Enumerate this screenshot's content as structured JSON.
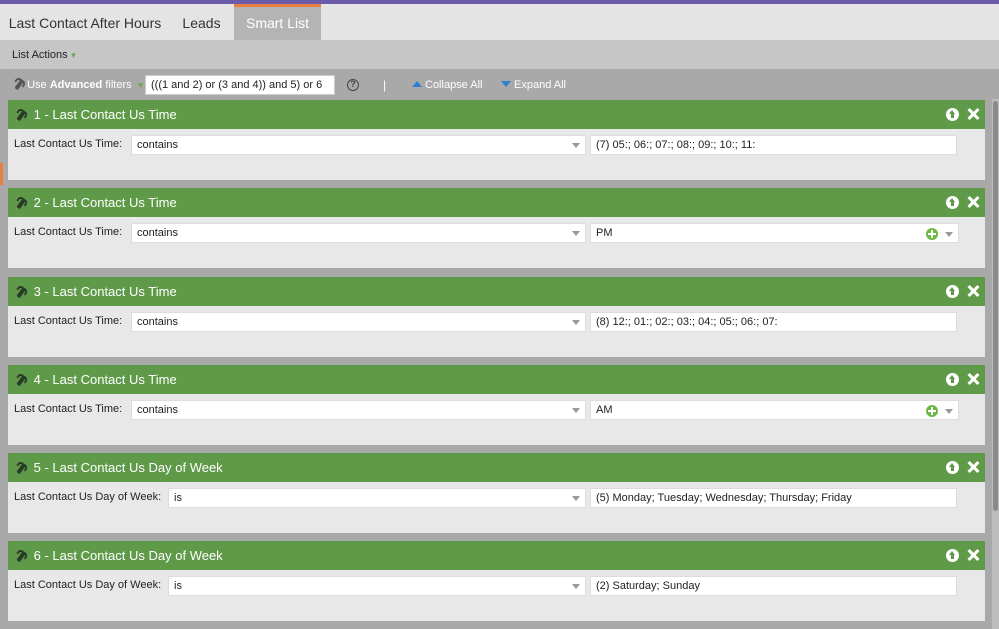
{
  "tabs": [
    {
      "label": "Last Contact After Hours"
    },
    {
      "label": "Leads"
    },
    {
      "label": "Smart List"
    }
  ],
  "list_actions": {
    "label": "List Actions"
  },
  "filter_bar": {
    "use_prefix": "Use ",
    "advanced": "Advanced",
    "filters_suffix": " filters",
    "logic_value": "(((1 and 2) or (3 and 4)) and 5) or 6",
    "separator": "|",
    "collapse_all": "Collapse All",
    "expand_all": "Expand All"
  },
  "filters": [
    {
      "title": "1 - Last Contact Us Time",
      "label": "Last Contact Us Time:",
      "operator": "contains",
      "value": "(7) 05:; 06:; 07:; 08:; 09:; 10:; 11:"
    },
    {
      "title": "2 - Last Contact Us Time",
      "label": "Last Contact Us Time:",
      "operator": "contains",
      "value": "PM"
    },
    {
      "title": "3 - Last Contact Us Time",
      "label": "Last Contact Us Time:",
      "operator": "contains",
      "value": "(8) 12:; 01:; 02:; 03:; 04:; 05:; 06:; 07:"
    },
    {
      "title": "4 - Last Contact Us Time",
      "label": "Last Contact Us Time:",
      "operator": "contains",
      "value": "AM"
    },
    {
      "title": "5 - Last Contact Us Day of Week",
      "label": "Last Contact Us Day of Week:",
      "operator": "is",
      "value": "(5) Monday; Tuesday; Wednesday; Thursday; Friday"
    },
    {
      "title": "6 - Last Contact Us Day of Week",
      "label": "Last Contact Us Day of Week:",
      "operator": "is",
      "value": "(2) Saturday; Sunday"
    }
  ],
  "colors": {
    "header_green": "#5f9a49",
    "active_tab_accent": "#e87e3f",
    "top_line": "#6b5ba8"
  }
}
